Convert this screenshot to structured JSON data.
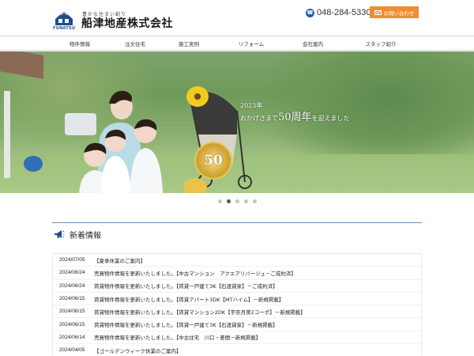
{
  "header": {
    "tagline": "豊かな住まい創り",
    "company_name": "船津地産株式会社",
    "brand": "FUNATSU",
    "phone": "048-284-5330",
    "contact_label": "お問い合わせ",
    "brand_color": "#1e4e8c",
    "accent_color": "#f28c2e"
  },
  "nav": {
    "items": [
      {
        "label": "物件情報"
      },
      {
        "label": "注文住宅"
      },
      {
        "label": "施工実例"
      },
      {
        "label": "リフォーム"
      },
      {
        "label": "会社案内"
      },
      {
        "label": "スタッフ紹介"
      }
    ]
  },
  "hero": {
    "badge_number": "50",
    "year_text": "2023年",
    "message_pre": "おかげさまで",
    "message_big": "50周年",
    "message_post": "を迎えました"
  },
  "carousel": {
    "total": 5,
    "active": 2
  },
  "news": {
    "title": "新着情報",
    "items": [
      {
        "date": "2024/07/05",
        "text": "【夏季休業のご案内】"
      },
      {
        "date": "2024/06/24",
        "text": "売買物件情報を更新いたしました。【中古マンション　アクエアリバージュ－ご成約済】"
      },
      {
        "date": "2024/06/24",
        "text": "賃貸物件情報を更新いたしました。【賃貸一戸建て3K【石渡貸家】－ご成約済】"
      },
      {
        "date": "2024/06/15",
        "text": "賃貸物件情報を更新いたしました。【賃貸アパート3DK【MTハイム】－新規掲載】"
      },
      {
        "date": "2024/06/15",
        "text": "賃貸物件情報を更新いたしました。【賃貸マンション2DK【宇奈月第2コーポ】－新規掲載】"
      },
      {
        "date": "2024/06/15",
        "text": "賃貸物件情報を更新いたしました。【賃貸一戸建て3K【石渡貸家】－新規掲載】"
      },
      {
        "date": "2024/06/14",
        "text": "売買物件情報を更新いたしました。【中古住宅　川口・差間－新規掲載】"
      },
      {
        "date": "2024/04/05",
        "text": "【ゴールデンウィーク休業のご案内】"
      }
    ]
  }
}
